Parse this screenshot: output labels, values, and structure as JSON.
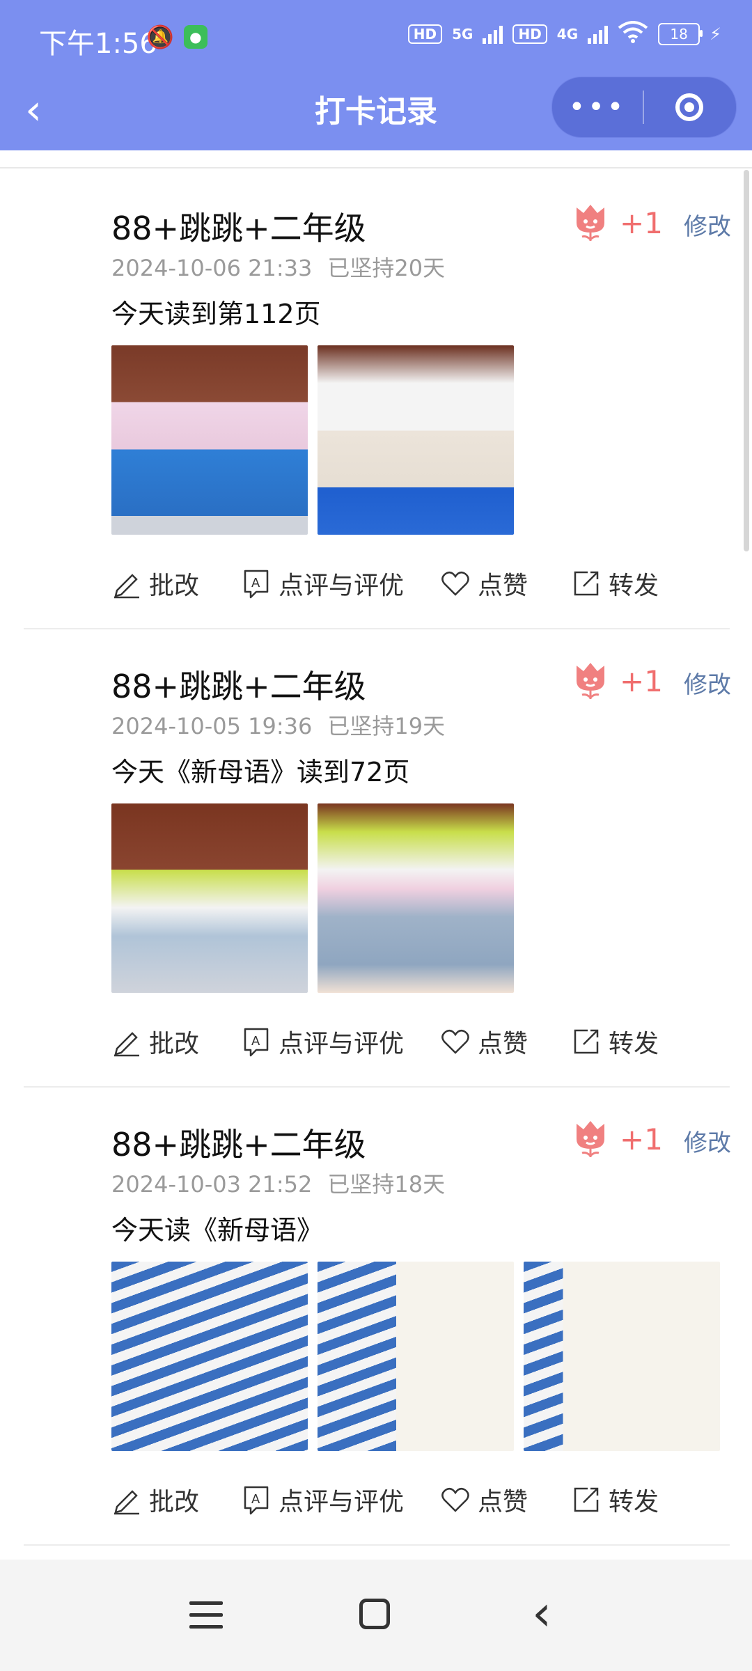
{
  "status": {
    "time": "下午1:56",
    "hd1": "HD",
    "net1": "5G",
    "hd2": "HD",
    "net2": "4G",
    "battery": "18"
  },
  "header": {
    "title": "打卡记录",
    "more": "•••"
  },
  "entries": [
    {
      "title": "88+跳跳+二年级",
      "datetime": "2024-10-06 21:33",
      "streak": "已坚持20天",
      "likes": "+1",
      "edit": "修改",
      "text": "今天读到第112页",
      "photos": 2
    },
    {
      "title": "88+跳跳+二年级",
      "datetime": "2024-10-05 19:36",
      "streak": "已坚持19天",
      "likes": "+1",
      "edit": "修改",
      "text": "今天《新母语》读到72页",
      "photos": 2
    },
    {
      "title": "88+跳跳+二年级",
      "datetime": "2024-10-03 21:52",
      "streak": "已坚持18天",
      "likes": "+1",
      "edit": "修改",
      "text": "今天读《新母语》",
      "photos": 3
    }
  ],
  "actions": {
    "correct": "批改",
    "review": "点评与评优",
    "like": "点赞",
    "share": "转发"
  },
  "colors": {
    "header": "#7b8ff0",
    "flower": "#f06e6e",
    "edit": "#5d7aa8"
  }
}
